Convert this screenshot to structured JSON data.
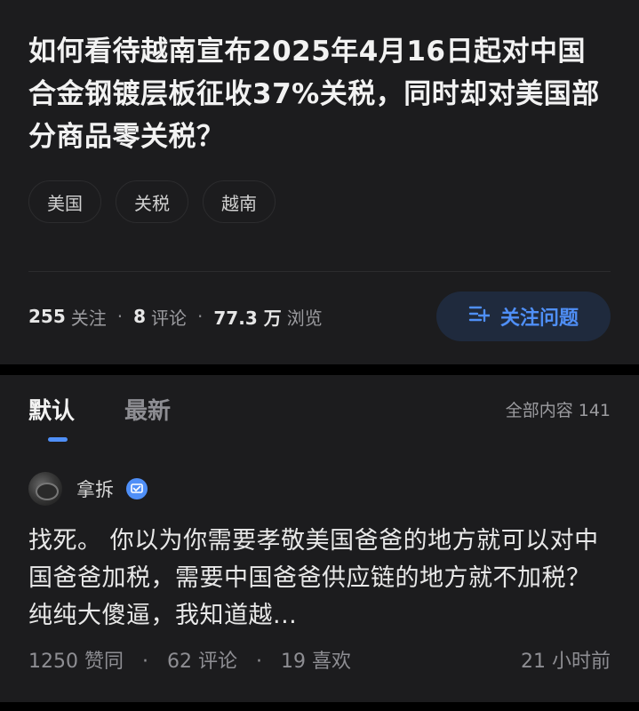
{
  "question": {
    "title": "如何看待越南宣布2025年4月16日起对中国合金钢镀层板征收37%关税，同时却对美国部分商品零关税？",
    "tags": [
      "美国",
      "关税",
      "越南"
    ],
    "stats": {
      "followers_num": "255",
      "followers_label": "关注",
      "comments_num": "8",
      "comments_label": "评论",
      "views_num": "77.3 万",
      "views_label": "浏览",
      "separator": "·"
    },
    "follow_button_label": "关注问题"
  },
  "answers": {
    "tabs": [
      "默认",
      "最新"
    ],
    "active_tab": "默认",
    "total_label": "全部内容 141",
    "item": {
      "author": "拿拆",
      "excerpt": "找死。 你以为你需要孝敬美国爸爸的地方就可以对中国爸爸加税，需要中国爸爸供应链的地方就不加税？ 纯纯大傻逼，我知道越...",
      "likes": "1250 赞同",
      "comments": "62 评论",
      "favorites": "19 喜欢",
      "time": "21 小时前",
      "separator": "·"
    }
  },
  "colors": {
    "background": "#000000",
    "card": "#1c1c1e",
    "accent": "#4f8ff7",
    "follow_button_bg": "#1f2a3d"
  }
}
